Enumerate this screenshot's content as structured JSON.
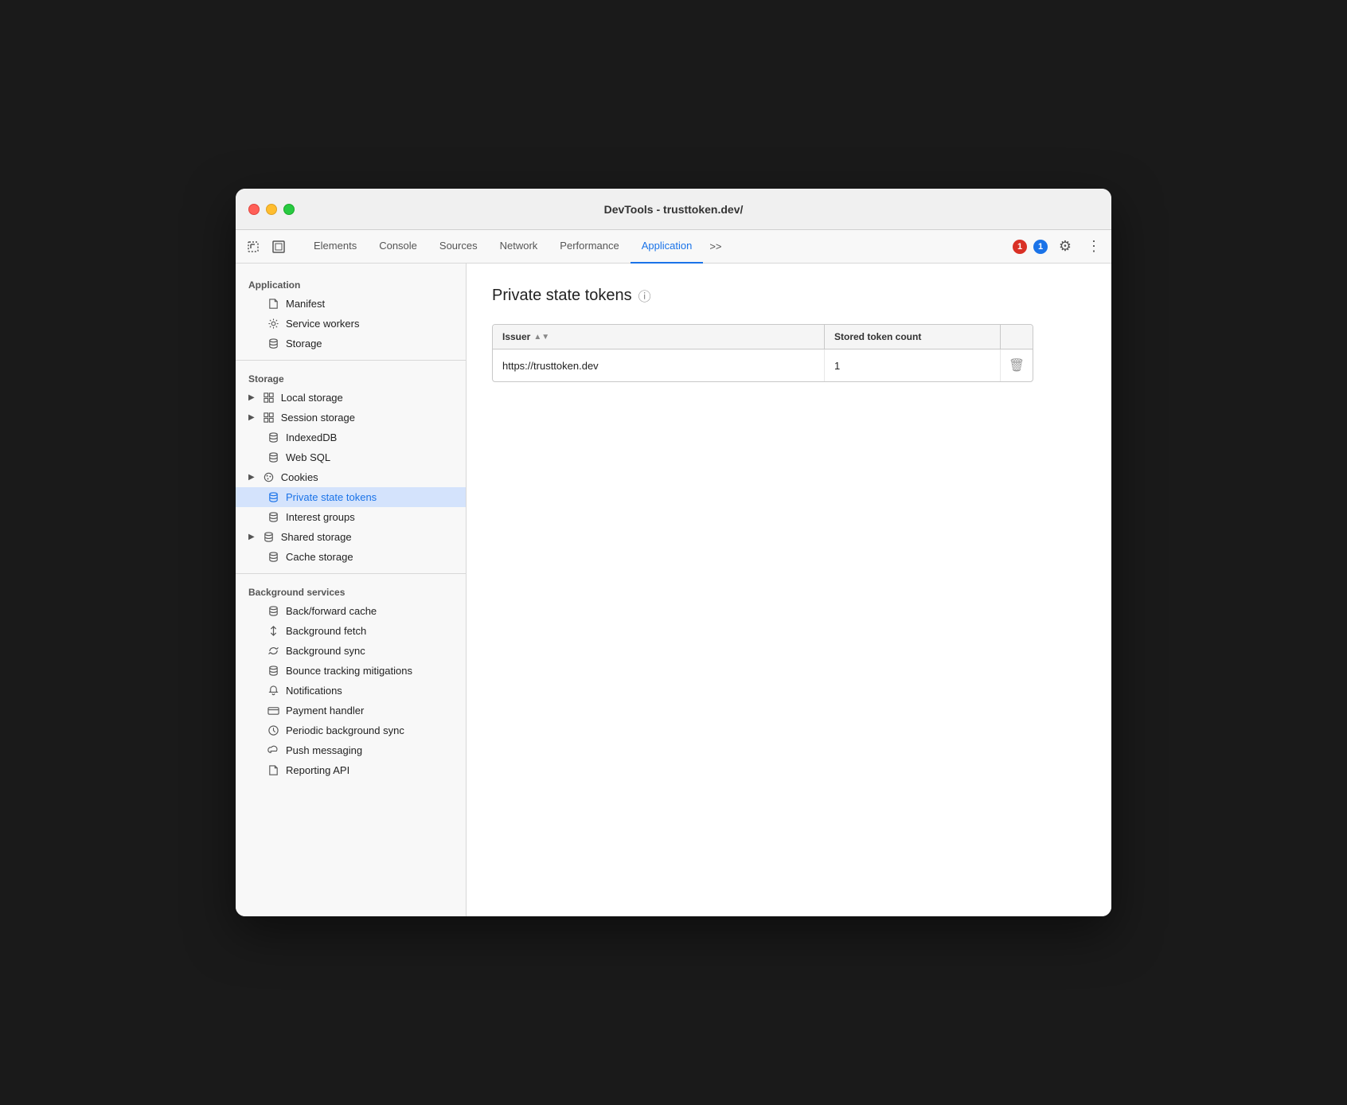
{
  "window": {
    "title": "DevTools - trusttoken.dev/"
  },
  "toolbar": {
    "tabs": [
      {
        "id": "elements",
        "label": "Elements",
        "active": false
      },
      {
        "id": "console",
        "label": "Console",
        "active": false
      },
      {
        "id": "sources",
        "label": "Sources",
        "active": false
      },
      {
        "id": "network",
        "label": "Network",
        "active": false
      },
      {
        "id": "performance",
        "label": "Performance",
        "active": false
      },
      {
        "id": "application",
        "label": "Application",
        "active": true
      }
    ],
    "more_label": ">>",
    "error_count": "1",
    "info_count": "1"
  },
  "sidebar": {
    "sections": [
      {
        "id": "application",
        "label": "Application",
        "items": [
          {
            "id": "manifest",
            "label": "Manifest",
            "icon": "file",
            "indent": 1
          },
          {
            "id": "service-workers",
            "label": "Service workers",
            "icon": "gear",
            "indent": 1
          },
          {
            "id": "storage",
            "label": "Storage",
            "icon": "db",
            "indent": 1
          }
        ]
      },
      {
        "id": "storage",
        "label": "Storage",
        "items": [
          {
            "id": "local-storage",
            "label": "Local storage",
            "icon": "grid",
            "indent": 1,
            "arrow": true
          },
          {
            "id": "session-storage",
            "label": "Session storage",
            "icon": "grid",
            "indent": 1,
            "arrow": true
          },
          {
            "id": "indexeddb",
            "label": "IndexedDB",
            "icon": "db",
            "indent": 1
          },
          {
            "id": "web-sql",
            "label": "Web SQL",
            "icon": "db",
            "indent": 1
          },
          {
            "id": "cookies",
            "label": "Cookies",
            "icon": "cookie",
            "indent": 1,
            "arrow": true
          },
          {
            "id": "private-state-tokens",
            "label": "Private state tokens",
            "icon": "db",
            "indent": 1,
            "active": true
          },
          {
            "id": "interest-groups",
            "label": "Interest groups",
            "icon": "db",
            "indent": 1
          },
          {
            "id": "shared-storage",
            "label": "Shared storage",
            "icon": "db",
            "indent": 1,
            "arrow": true
          },
          {
            "id": "cache-storage",
            "label": "Cache storage",
            "icon": "db",
            "indent": 1
          }
        ]
      },
      {
        "id": "background-services",
        "label": "Background services",
        "items": [
          {
            "id": "back-forward-cache",
            "label": "Back/forward cache",
            "icon": "db",
            "indent": 1
          },
          {
            "id": "background-fetch",
            "label": "Background fetch",
            "icon": "arrow-updown",
            "indent": 1
          },
          {
            "id": "background-sync",
            "label": "Background sync",
            "icon": "sync",
            "indent": 1
          },
          {
            "id": "bounce-tracking",
            "label": "Bounce tracking mitigations",
            "icon": "db",
            "indent": 1
          },
          {
            "id": "notifications",
            "label": "Notifications",
            "icon": "bell",
            "indent": 1
          },
          {
            "id": "payment-handler",
            "label": "Payment handler",
            "icon": "card",
            "indent": 1
          },
          {
            "id": "periodic-background-sync",
            "label": "Periodic background sync",
            "icon": "clock",
            "indent": 1
          },
          {
            "id": "push-messaging",
            "label": "Push messaging",
            "icon": "cloud",
            "indent": 1
          },
          {
            "id": "reporting-api",
            "label": "Reporting API",
            "icon": "file",
            "indent": 1
          }
        ]
      }
    ]
  },
  "content": {
    "title": "Private state tokens",
    "table": {
      "columns": [
        {
          "id": "issuer",
          "label": "Issuer",
          "sortable": true
        },
        {
          "id": "token-count",
          "label": "Stored token count",
          "sortable": false
        }
      ],
      "rows": [
        {
          "issuer": "https://trusttoken.dev",
          "token_count": "1"
        }
      ]
    }
  }
}
